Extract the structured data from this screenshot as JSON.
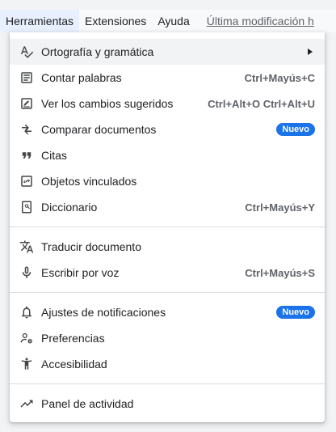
{
  "menubar": {
    "items": [
      "Herramientas",
      "Extensiones",
      "Ayuda"
    ],
    "last_modified": "Última modificación h"
  },
  "menu": {
    "groups": [
      [
        {
          "label": "Ortografía y gramática",
          "icon": "spellcheck-icon",
          "shortcut": "",
          "badge": "",
          "submenu": true
        },
        {
          "label": "Contar palabras",
          "icon": "word-count-icon",
          "shortcut": "Ctrl+Mayús+C"
        },
        {
          "label": "Ver los cambios sugeridos",
          "icon": "suggested-changes-icon",
          "shortcut": "Ctrl+Alt+O Ctrl+Alt+U"
        },
        {
          "label": "Comparar documentos",
          "icon": "compare-icon",
          "badge": "Nuevo"
        },
        {
          "label": "Citas",
          "icon": "quote-icon"
        },
        {
          "label": "Objetos vinculados",
          "icon": "linked-objects-icon"
        },
        {
          "label": "Diccionario",
          "icon": "dictionary-icon",
          "shortcut": "Ctrl+Mayús+Y"
        }
      ],
      [
        {
          "label": "Traducir documento",
          "icon": "translate-icon"
        },
        {
          "label": "Escribir por voz",
          "icon": "microphone-icon",
          "shortcut": "Ctrl+Mayús+S"
        }
      ],
      [
        {
          "label": "Ajustes de notificaciones",
          "icon": "bell-icon",
          "badge": "Nuevo"
        },
        {
          "label": "Preferencias",
          "icon": "preferences-icon"
        },
        {
          "label": "Accesibilidad",
          "icon": "accessibility-icon"
        }
      ],
      [
        {
          "label": "Panel de actividad",
          "icon": "trending-up-icon"
        }
      ]
    ]
  },
  "colors": {
    "accent": "#1a73e8",
    "text": "#202124",
    "muted": "#5f6368",
    "highlight": "#f1f3f4"
  }
}
